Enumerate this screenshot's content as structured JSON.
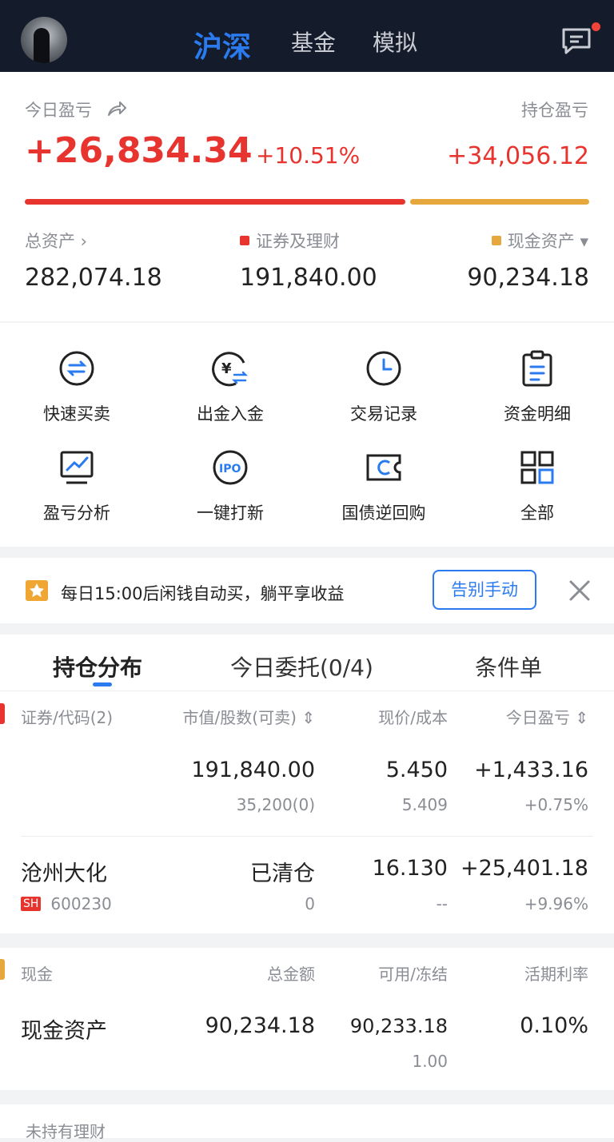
{
  "nav": {
    "tabs": [
      {
        "label": "沪深"
      },
      {
        "label": "基金"
      },
      {
        "label": "模拟"
      }
    ]
  },
  "summary": {
    "today_label": "今日盈亏",
    "today_value": "+26,834.34",
    "today_pct": "+10.51%",
    "hold_label": "持仓盈亏",
    "hold_value": "+34,056.12",
    "total_label": "总资产 ›",
    "total_value": "282,074.18",
    "sec_label": "证券及理财",
    "sec_value": "191,840.00",
    "cash_label": "现金资产 ▾",
    "cash_value": "90,234.18",
    "ratio_securities": 0.68,
    "colors": {
      "red": "#e8342e",
      "yellow": "#e6a83c"
    }
  },
  "shortcuts": [
    {
      "label": "快速买卖",
      "icon": "exchange-icon"
    },
    {
      "label": "出金入金",
      "icon": "yen-transfer-icon"
    },
    {
      "label": "交易记录",
      "icon": "clock-icon"
    },
    {
      "label": "资金明细",
      "icon": "clipboard-icon"
    },
    {
      "label": "盈亏分析",
      "icon": "chart-monitor-icon"
    },
    {
      "label": "一键打新",
      "icon": "ipo-icon"
    },
    {
      "label": "国债逆回购",
      "icon": "ticket-icon"
    },
    {
      "label": "全部",
      "icon": "grid-icon"
    }
  ],
  "banner": {
    "text": "每日15:00后闲钱自动买，躺平享收益",
    "button": "告别手动"
  },
  "holdings": {
    "tabs": [
      {
        "label": "持仓分布"
      },
      {
        "label": "今日委托(0/4)"
      },
      {
        "label": "条件单"
      }
    ],
    "headers": {
      "name": "证券/代码(2)",
      "value": "市值/股数(可卖)",
      "price": "现价/成本",
      "pnl": "今日盈亏"
    },
    "rows": [
      {
        "name": "",
        "code": "",
        "value": "191,840.00",
        "shares": "35,200(0)",
        "price": "5.450",
        "cost": "5.409",
        "pnl": "+1,433.16",
        "pnl_pct": "+0.75%"
      },
      {
        "name": "沧州大化",
        "market": "SH",
        "code": "600230",
        "value": "已清仓",
        "shares": "0",
        "price": "16.130",
        "cost": "--",
        "pnl": "+25,401.18",
        "pnl_pct": "+9.96%"
      }
    ]
  },
  "cash": {
    "headers": {
      "name": "现金",
      "total": "总金额",
      "avail": "可用/冻结",
      "rate": "活期利率"
    },
    "row": {
      "name": "现金资产",
      "total": "90,234.18",
      "avail": "90,233.18",
      "frozen": "1.00",
      "rate": "0.10%"
    }
  },
  "more": {
    "label": "未持有理财"
  }
}
